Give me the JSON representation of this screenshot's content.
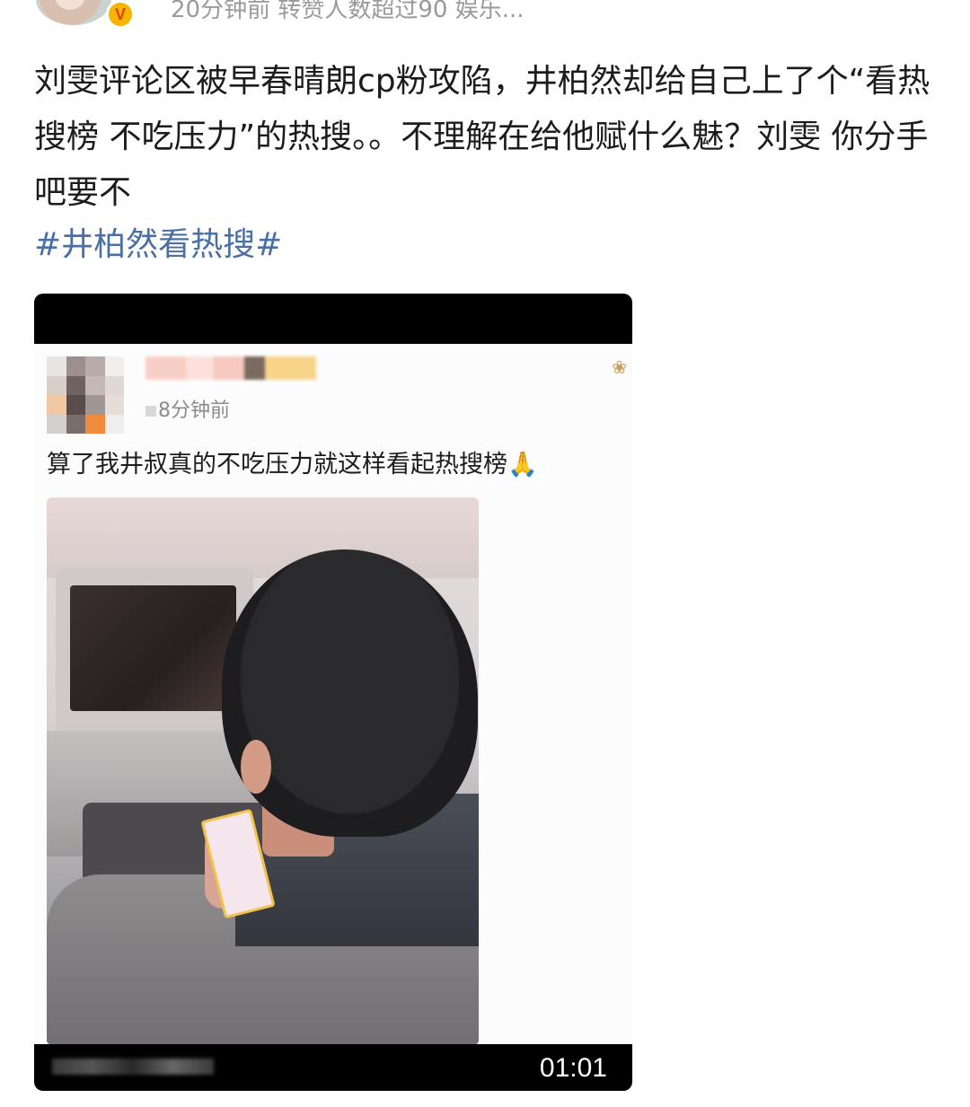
{
  "header": {
    "meta": "20分钟前 转赞人数超过90 娱乐..."
  },
  "post": {
    "text": "刘雯评论区被早春晴朗cp粉攻陷，井柏然却给自己上了个“看热搜榜 不吃压力”的热搜。。不理解在给他赋什么魅？刘雯 你分手吧要不",
    "hashtag": "#井柏然看热搜#"
  },
  "embedded_video": {
    "inner_time": "8分钟前",
    "inner_text": "算了我井叔真的不吃压力就这样看起热搜榜",
    "duration": "01:01"
  },
  "colors": {
    "hashtag": "#4a6fa5",
    "badge": "#f7b500",
    "meta_text": "#9a9a9a"
  }
}
